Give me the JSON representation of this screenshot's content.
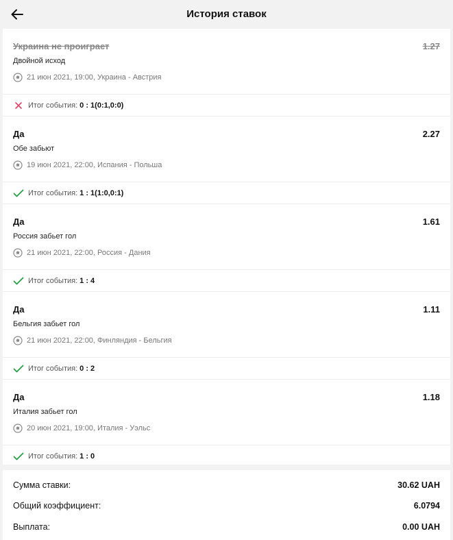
{
  "header": {
    "title": "История ставок"
  },
  "bets": [
    {
      "pick": "Украина не проиграет",
      "odds": "1.27",
      "market": "Двойной исход",
      "event": "21 июн 2021, 19:00, Украина - Австрия",
      "result_label": "Итог события:",
      "result_score": "0 : 1(0:1,0:0)",
      "status": "lost"
    },
    {
      "pick": "Да",
      "odds": "2.27",
      "market": "Обе забьют",
      "event": "19 июн 2021, 22:00, Испания - Польша",
      "result_label": "Итог события:",
      "result_score": "1 : 1(1:0,0:1)",
      "status": "won"
    },
    {
      "pick": "Да",
      "odds": "1.61",
      "market": "Россия забьет гол",
      "event": "21 июн 2021, 22:00, Россия - Дания",
      "result_label": "Итог события:",
      "result_score": "1 : 4",
      "status": "won"
    },
    {
      "pick": "Да",
      "odds": "1.11",
      "market": "Бельгия забьет гол",
      "event": "21 июн 2021, 22:00, Финляндия - Бельгия",
      "result_label": "Итог события:",
      "result_score": "0 : 2",
      "status": "won"
    },
    {
      "pick": "Да",
      "odds": "1.18",
      "market": "Италия забьет гол",
      "event": "20 июн 2021, 19:00, Италия - Уэльс",
      "result_label": "Итог события:",
      "result_score": "1 : 0",
      "status": "won"
    }
  ],
  "summary": {
    "stake_label": "Сумма ставки:",
    "stake_value": "30.62 UAH",
    "coef_label": "Общий коэффициент:",
    "coef_value": "6.0794",
    "payout_label": "Выплата:",
    "payout_value": "0.00 UAH"
  },
  "colors": {
    "won": "#2a9d4b",
    "lost": "#d9436a",
    "text": "#111111",
    "muted": "#777777"
  }
}
